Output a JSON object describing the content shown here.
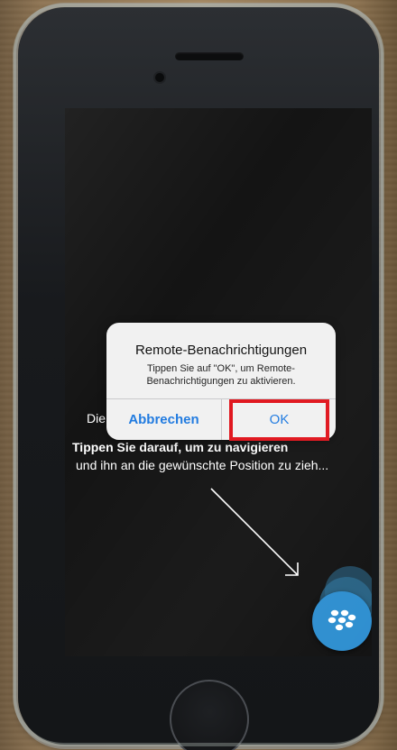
{
  "dialog": {
    "title": "Remote-Benachrichtigungen",
    "message": "Tippen Sie auf \"OK\", um Remote-Benachrichtigungen zu aktivieren.",
    "cancel_label": "Abbrechen",
    "ok_label": "OK"
  },
  "hint": {
    "line1": "Die",
    "line2": "Tippen Sie darauf, um zu navigieren",
    "line3": "und ihn an die gewünschte Position zu zieh..."
  },
  "floating_button": {
    "icon": "blackberry-logo-icon",
    "color": "#2f8fd0"
  },
  "colors": {
    "ios_blue": "#1f7ae0",
    "highlight_red": "#e0141c"
  }
}
